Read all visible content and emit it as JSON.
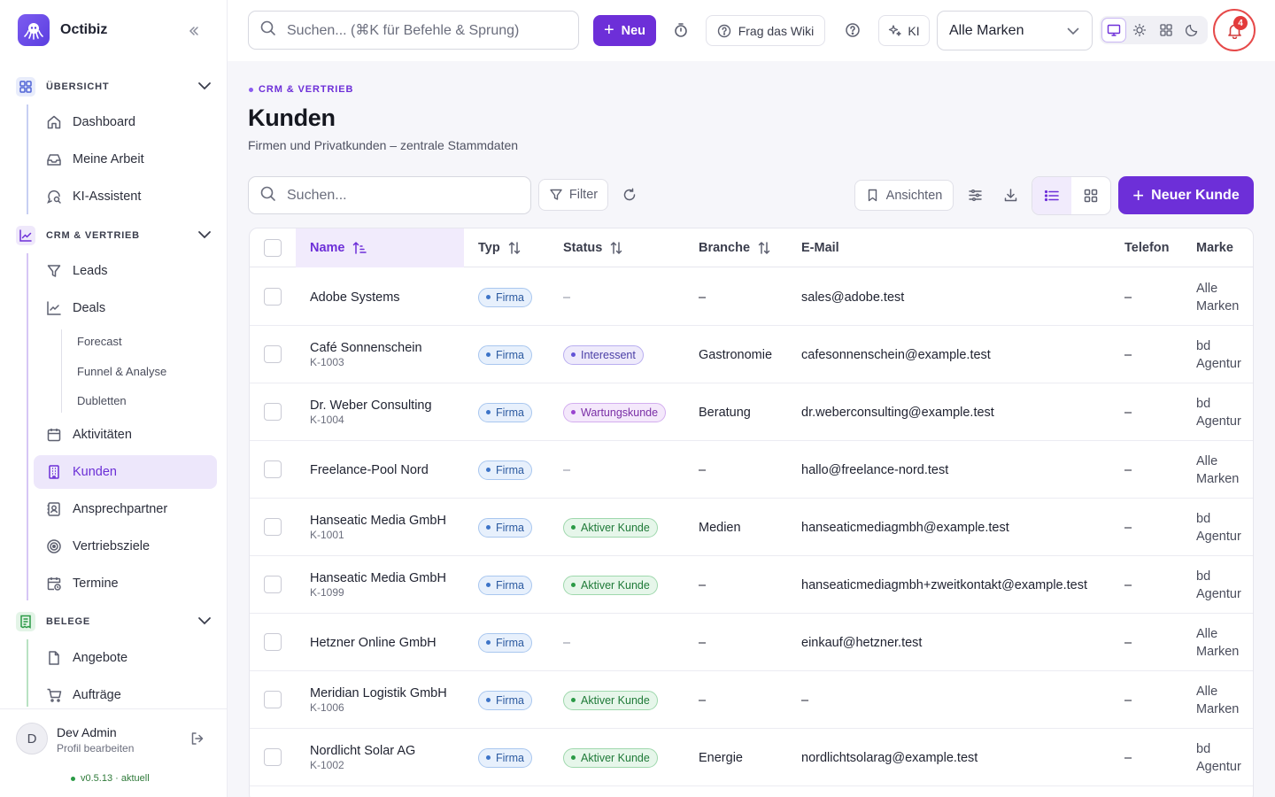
{
  "app": {
    "name": "Octibiz"
  },
  "sidebar": {
    "sections": [
      {
        "label": "ÜBERSICHT",
        "items": [
          "Dashboard",
          "Meine Arbeit",
          "KI-Assistent"
        ]
      },
      {
        "label": "CRM & VERTRIEB",
        "items": [
          "Leads",
          "Deals",
          "Aktivitäten",
          "Kunden",
          "Ansprechpartner",
          "Vertriebsziele",
          "Termine"
        ],
        "subitems": [
          "Forecast",
          "Funnel & Analyse",
          "Dubletten"
        ]
      },
      {
        "label": "BELEGE",
        "items": [
          "Angebote",
          "Aufträge"
        ]
      }
    ],
    "active_item": "Kunden",
    "user": {
      "initial": "D",
      "name": "Dev Admin",
      "subtitle": "Profil bearbeiten"
    },
    "version": "v0.5.13 · aktuell"
  },
  "topbar": {
    "search_placeholder": "Suchen... (⌘K für Befehle & Sprung)",
    "new_label": "Neu",
    "wiki_label": "Frag das Wiki",
    "ki_label": "KI",
    "brand_select": "Alle Marken",
    "notifications_count": "4"
  },
  "page": {
    "eyebrow": "CRM & VERTRIEB",
    "title": "Kunden",
    "subtitle": "Firmen und Privatkunden – zentrale Stammdaten"
  },
  "toolbar": {
    "search_placeholder": "Suchen...",
    "filter_label": "Filter",
    "views_label": "Ansichten",
    "new_customer_label": "Neuer Kunde"
  },
  "table": {
    "columns": [
      "Name",
      "Typ",
      "Status",
      "Branche",
      "E-Mail",
      "Telefon",
      "Marke"
    ],
    "sorted_column": "Name",
    "rows": [
      {
        "name": "Adobe Systems",
        "id": "",
        "typ": "Firma",
        "status": "–",
        "status_kind": "none",
        "branche": "–",
        "email": "sales@adobe.test",
        "telefon": "–",
        "marke1": "Alle",
        "marke2": "Marken"
      },
      {
        "name": "Café Sonnenschein",
        "id": "K-1003",
        "typ": "Firma",
        "status": "Interessent",
        "status_kind": "interessent",
        "branche": "Gastronomie",
        "email": "cafesonnenschein@example.test",
        "telefon": "–",
        "marke1": "bd",
        "marke2": "Agentur"
      },
      {
        "name": "Dr. Weber Consulting",
        "id": "K-1004",
        "typ": "Firma",
        "status": "Wartungskunde",
        "status_kind": "wartung",
        "branche": "Beratung",
        "email": "dr.weberconsulting@example.test",
        "telefon": "–",
        "marke1": "bd",
        "marke2": "Agentur"
      },
      {
        "name": "Freelance-Pool Nord",
        "id": "",
        "typ": "Firma",
        "status": "–",
        "status_kind": "none",
        "branche": "–",
        "email": "hallo@freelance-nord.test",
        "telefon": "–",
        "marke1": "Alle",
        "marke2": "Marken"
      },
      {
        "name": "Hanseatic Media GmbH",
        "id": "K-1001",
        "typ": "Firma",
        "status": "Aktiver Kunde",
        "status_kind": "aktiv",
        "branche": "Medien",
        "email": "hanseaticmediagmbh@example.test",
        "telefon": "–",
        "marke1": "bd",
        "marke2": "Agentur"
      },
      {
        "name": "Hanseatic Media GmbH",
        "id": "K-1099",
        "typ": "Firma",
        "status": "Aktiver Kunde",
        "status_kind": "aktiv",
        "branche": "–",
        "email": "hanseaticmediagmbh+zweitkontakt@example.test",
        "telefon": "–",
        "marke1": "bd",
        "marke2": "Agentur"
      },
      {
        "name": "Hetzner Online GmbH",
        "id": "",
        "typ": "Firma",
        "status": "–",
        "status_kind": "none",
        "branche": "–",
        "email": "einkauf@hetzner.test",
        "telefon": "–",
        "marke1": "Alle",
        "marke2": "Marken"
      },
      {
        "name": "Meridian Logistik GmbH",
        "id": "K-1006",
        "typ": "Firma",
        "status": "Aktiver Kunde",
        "status_kind": "aktiv",
        "branche": "–",
        "email": "–",
        "telefon": "–",
        "marke1": "Alle",
        "marke2": "Marken"
      },
      {
        "name": "Nordlicht Solar AG",
        "id": "K-1002",
        "typ": "Firma",
        "status": "Aktiver Kunde",
        "status_kind": "aktiv",
        "branche": "Energie",
        "email": "nordlichtsolarag@example.test",
        "telefon": "–",
        "marke1": "bd",
        "marke2": "Agentur"
      }
    ]
  },
  "colors": {
    "accent": "#6d2fd8",
    "active_bg": "#ede7fb",
    "danger": "#e33b3b",
    "success": "#2b9a46"
  }
}
